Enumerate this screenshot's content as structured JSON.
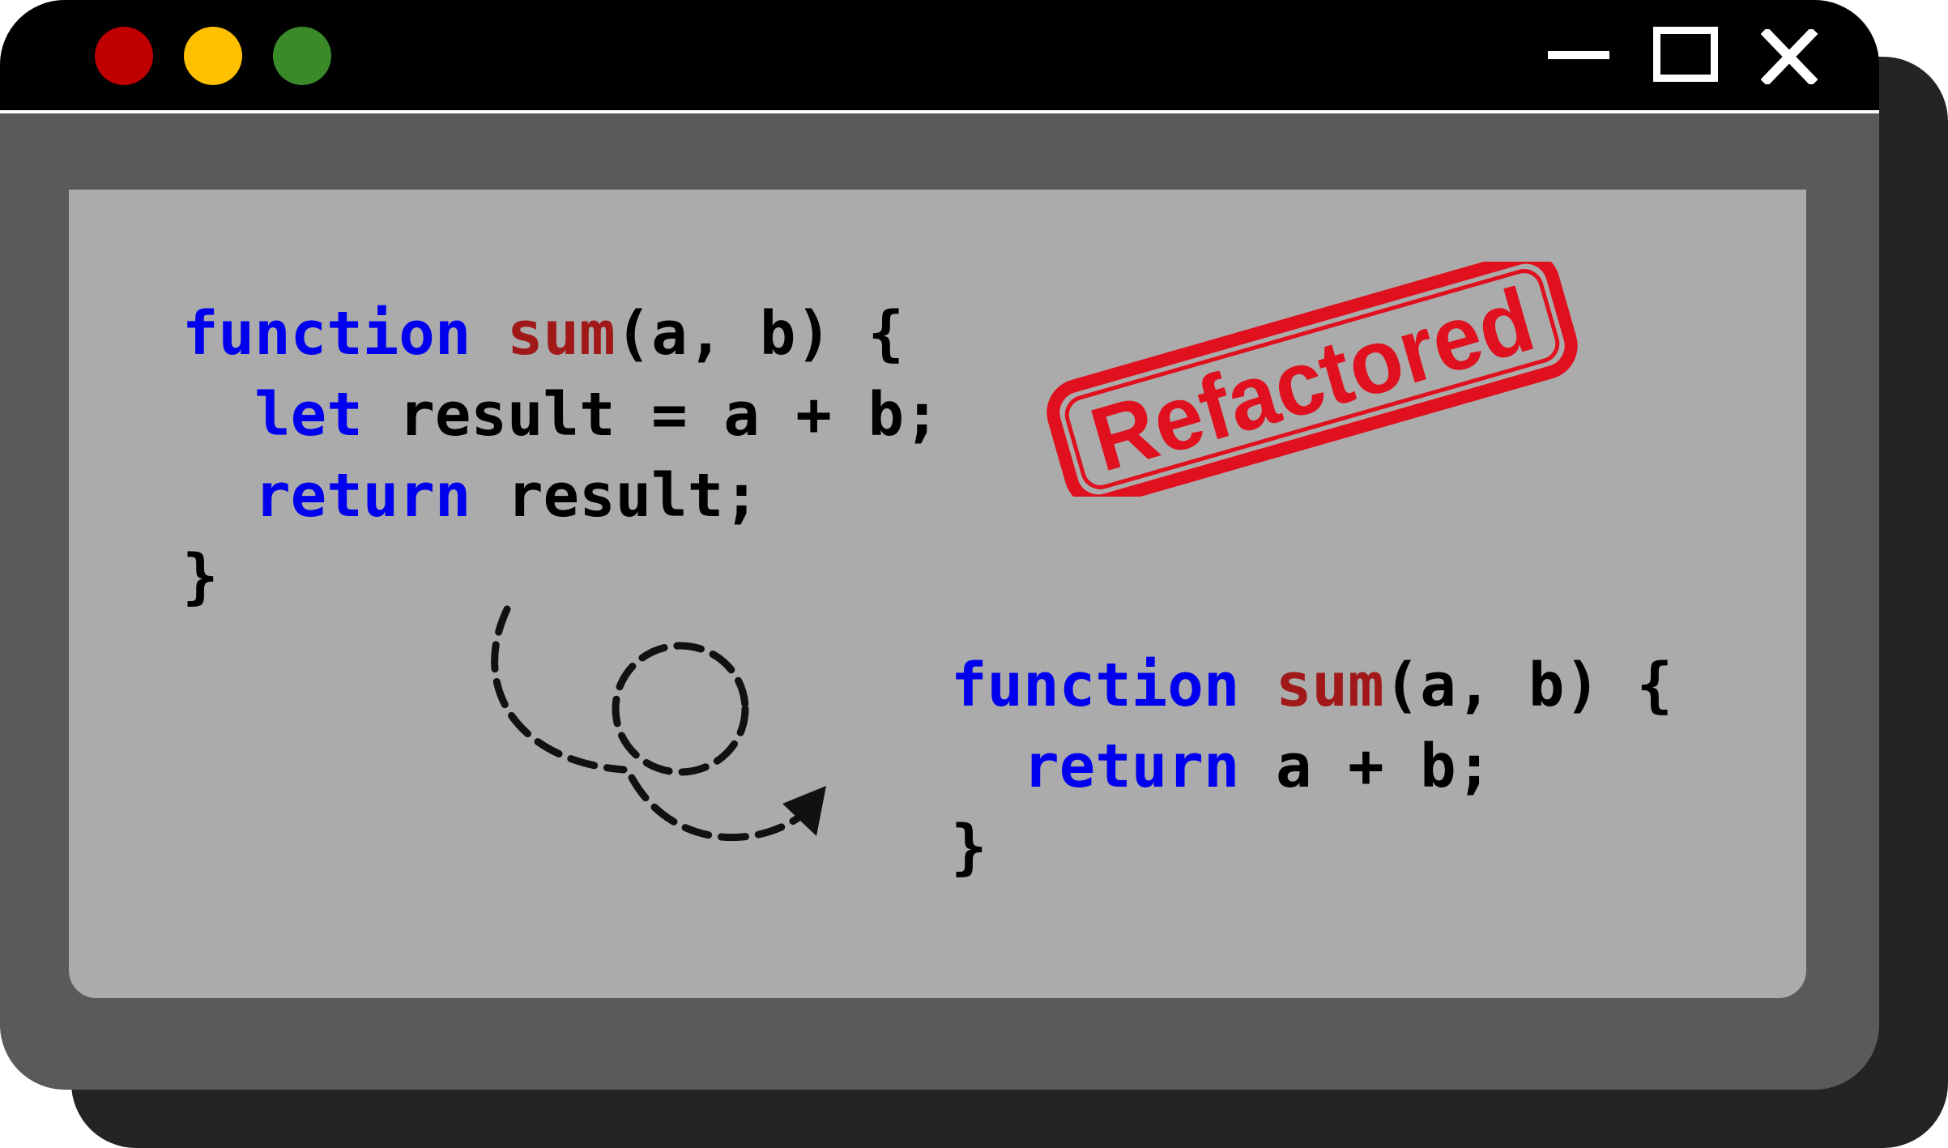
{
  "window": {
    "traffic_lights": [
      {
        "name": "close-light",
        "color": "#c00000"
      },
      {
        "name": "minimize-light",
        "color": "#ffc000"
      },
      {
        "name": "zoom-light",
        "color": "#3a8a2a"
      }
    ],
    "controls": {
      "minimize_icon": "minimize-icon",
      "maximize_icon": "maximize-icon",
      "close_icon": "close-icon"
    }
  },
  "colors": {
    "keyword": "#0000ee",
    "function_name": "#a01818",
    "text": "#000000",
    "stamp": "#e0101e"
  },
  "code_before": {
    "line1": {
      "kw": "function",
      "sp": " ",
      "fn": "sum",
      "rest": "(a, b) {"
    },
    "line2": {
      "indent": "  ",
      "kw": "let",
      "rest": " result = a + b;"
    },
    "line3": {
      "indent": "  ",
      "kw": "return",
      "rest": " result;"
    },
    "line4": {
      "rest": "}"
    }
  },
  "code_after": {
    "line1": {
      "kw": "function",
      "sp": " ",
      "fn": "sum",
      "rest": "(a, b) {"
    },
    "line2": {
      "indent": "  ",
      "kw": "return",
      "rest": " a + b;"
    },
    "line3": {
      "rest": "}"
    }
  },
  "stamp": {
    "text": "Refactored"
  },
  "arrow": {
    "icon": "dashed-loop-arrow-icon"
  }
}
